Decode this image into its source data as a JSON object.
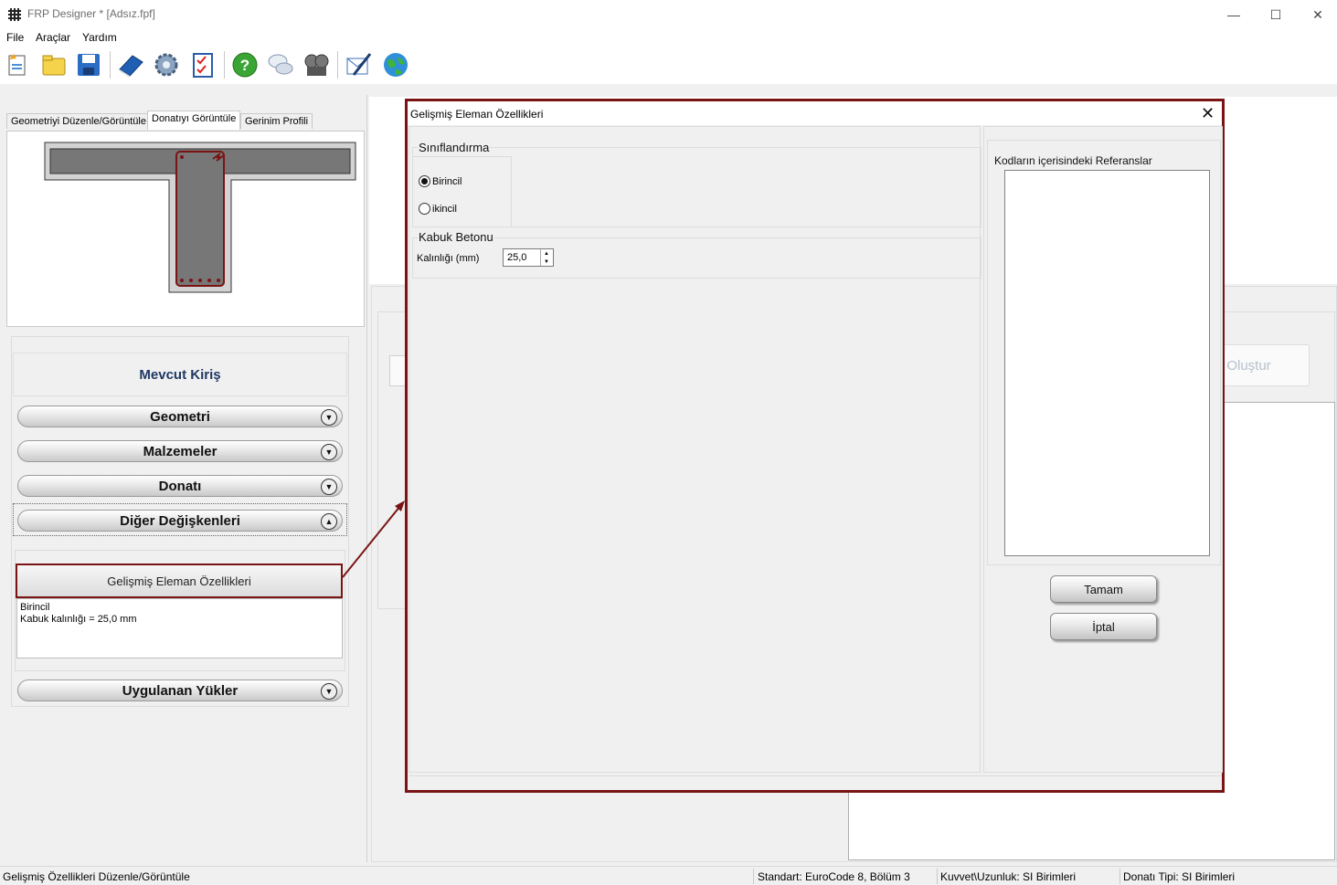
{
  "window": {
    "title": "FRP Designer * [Adsız.fpf]",
    "controls": [
      "—",
      "☐",
      "✕"
    ]
  },
  "menu": [
    "File",
    "Araçlar",
    "Yardım"
  ],
  "toolbar_icons": [
    "new-file-icon",
    "open-folder-icon",
    "save-icon",
    "book-icon",
    "settings-icon",
    "checklist-icon",
    "help-icon",
    "chat-icon",
    "film-icon",
    "email-icon",
    "globe-icon"
  ],
  "left": {
    "tabs": [
      "Geometriyi Düzenle/Görüntüle",
      "Donatıyı Görüntüle",
      "Gerinim Profili"
    ],
    "section_title": "Mevcut Kiriş",
    "accordion": [
      "Geometri",
      "Malzemeler",
      "Donatı",
      "Diğer Değişkenleri",
      "Uygulanan Yükler"
    ],
    "advanced_button": "Gelişmiş Eleman Özellikleri",
    "summary_lines": [
      "Birincil",
      "Kabuk kalınlığı = 25,0 mm"
    ]
  },
  "background": {
    "olustur_label": "Oluştur"
  },
  "status": {
    "left": "Gelişmiş Özellikleri Düzenle/Görüntüle",
    "standard": "Standart: EuroCode 8, Bölüm 3",
    "units": "Kuvvet\\Uzunluk: SI Birimleri",
    "rebar": "Donatı Tipi: SI Birimleri"
  },
  "dialog": {
    "title": "Gelişmiş Eleman Özellikleri",
    "close": "✕",
    "classification_label": "Sınıflandırma",
    "radio_primary": "Birincil",
    "radio_secondary": "ikincil",
    "primary_selected": true,
    "shell_label": "Kabuk Betonu",
    "thickness_label": "Kalınlığı (mm)",
    "thickness_value": "25,0",
    "references_label": "Kodların içerisindeki Referanslar",
    "ok_button": "Tamam",
    "cancel_button": "İptal"
  },
  "colors": {
    "highlight": "#7a1414",
    "section_title": "#1f3864"
  }
}
